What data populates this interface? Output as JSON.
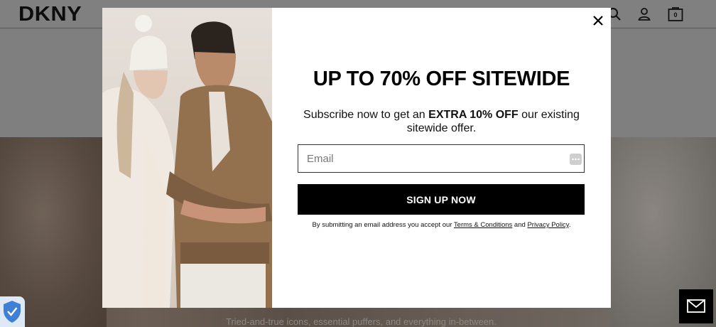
{
  "header": {
    "logo": "DKNY",
    "cart_count": "0"
  },
  "hero": {
    "caption": "Tried-and-true icons, essential puffers, and everything in-between."
  },
  "modal": {
    "headline": "UP TO 70% OFF SITEWIDE",
    "subtitle_pre": "Subscribe now to get an ",
    "subtitle_bold": "EXTRA 10% OFF",
    "subtitle_post": " our existing sitewide offer.",
    "email_placeholder": "Email",
    "button_label": "SIGN UP NOW",
    "legal_pre": "By submitting an email address you accept our ",
    "legal_terms": "Terms & Conditions",
    "legal_mid": " and ",
    "legal_privacy": "Privacy Policy",
    "legal_post": "."
  },
  "colors": {
    "overlay_bg": "#7d7d7d",
    "modal_bg": "#ffffff",
    "button_bg": "#000000",
    "button_text": "#ffffff"
  },
  "icons": [
    "search-icon",
    "account-icon",
    "cart-icon",
    "close-icon",
    "shield-icon",
    "mail-icon",
    "password-manager-icon"
  ]
}
